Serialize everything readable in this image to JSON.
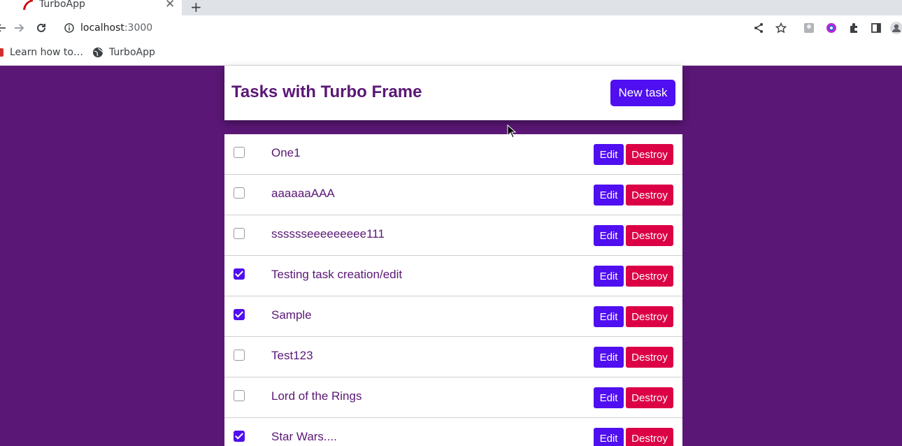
{
  "browser": {
    "tab_title": "TurboApp",
    "url_host": "localhost",
    "url_port": ":3000",
    "bookmarks": [
      "Learn how to…",
      "TurboApp"
    ]
  },
  "header": {
    "title": "Tasks with Turbo Frame",
    "new_task_label": "New task"
  },
  "tasks": [
    {
      "title": "One1",
      "done": false
    },
    {
      "title": "aaaaaaAAA",
      "done": false
    },
    {
      "title": "sssssseeeeeeeee111",
      "done": false
    },
    {
      "title": "Testing task creation/edit",
      "done": true
    },
    {
      "title": "Sample",
      "done": true
    },
    {
      "title": "Test123",
      "done": false
    },
    {
      "title": "Lord of the Rings",
      "done": false
    },
    {
      "title": "Star Wars....",
      "done": true
    }
  ],
  "row_actions": {
    "edit_label": "Edit",
    "destroy_label": "Destroy"
  },
  "colors": {
    "page_background": "#5a1775",
    "primary": "#4f0ff0",
    "danger": "#dc0145"
  }
}
